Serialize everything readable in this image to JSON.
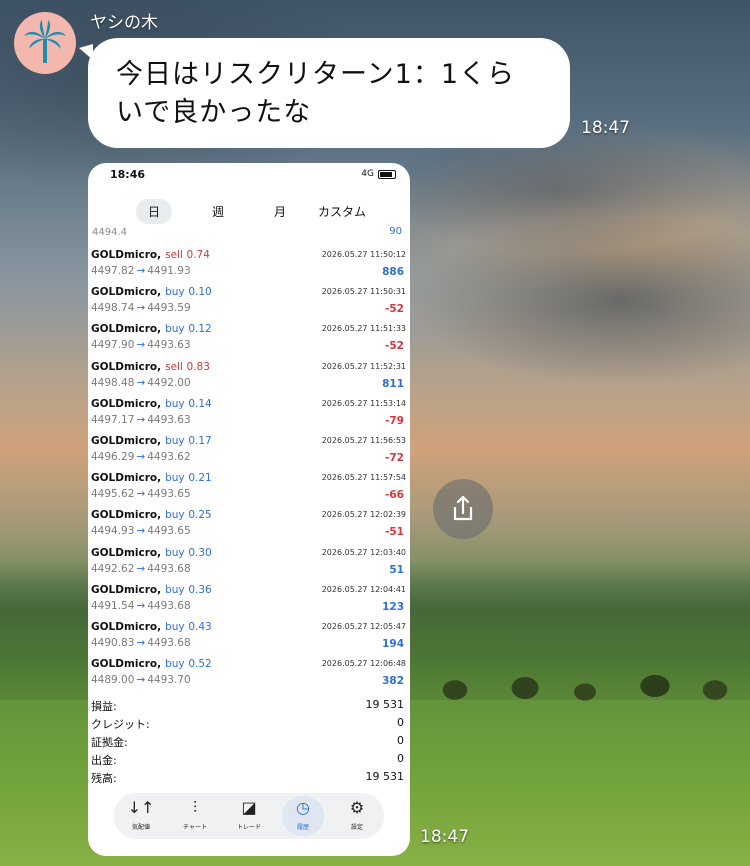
{
  "chat": {
    "sender_name": "ヤシの木",
    "message_text_line1": "今日はリスクリターン1：1くら",
    "message_text_line2": "いで良かったな",
    "message_time": "18:47",
    "image_time": "18:47",
    "avatar_icon": "palm-tree-icon",
    "share_icon": "share-icon"
  },
  "screenshot": {
    "status_time": "18:46",
    "status_right": "4G",
    "tabs": [
      {
        "label": "日",
        "active": true
      },
      {
        "label": "週",
        "active": false
      },
      {
        "label": "月",
        "active": false
      },
      {
        "label": "カスタム",
        "active": false
      }
    ],
    "strip": {
      "left": "4494.4",
      "right": "90"
    },
    "trades": [
      {
        "symbol": "GOLDmicro,",
        "side": "sell",
        "volume": "0.74",
        "datetime": "2026.05.27 11:50:12",
        "open": "4497.82",
        "close": "4491.93",
        "profit": "886",
        "profit_sign": "pos"
      },
      {
        "symbol": "GOLDmicro,",
        "side": "buy",
        "volume": "0.10",
        "datetime": "2026.05.27 11:50:31",
        "open": "4498.74",
        "close": "4493.59",
        "profit": "-52",
        "profit_sign": "neg"
      },
      {
        "symbol": "GOLDmicro,",
        "side": "buy",
        "volume": "0.12",
        "datetime": "2026.05.27 11:51:33",
        "open": "4497.90",
        "close": "4493.63",
        "profit": "-52",
        "profit_sign": "neg"
      },
      {
        "symbol": "GOLDmicro,",
        "side": "sell",
        "volume": "0.83",
        "datetime": "2026.05.27 11:52:31",
        "open": "4498.48",
        "close": "4492.00",
        "profit": "811",
        "profit_sign": "pos"
      },
      {
        "symbol": "GOLDmicro,",
        "side": "buy",
        "volume": "0.14",
        "datetime": "2026.05.27 11:53:14",
        "open": "4497.17",
        "close": "4493.63",
        "profit": "-79",
        "profit_sign": "neg"
      },
      {
        "symbol": "GOLDmicro,",
        "side": "buy",
        "volume": "0.17",
        "datetime": "2026.05.27 11:56:53",
        "open": "4496.29",
        "close": "4493.62",
        "profit": "-72",
        "profit_sign": "neg"
      },
      {
        "symbol": "GOLDmicro,",
        "side": "buy",
        "volume": "0.21",
        "datetime": "2026.05.27 11:57:54",
        "open": "4495.62",
        "close": "4493.65",
        "profit": "-66",
        "profit_sign": "neg"
      },
      {
        "symbol": "GOLDmicro,",
        "side": "buy",
        "volume": "0.25",
        "datetime": "2026.05.27 12:02:39",
        "open": "4494.93",
        "close": "4493.65",
        "profit": "-51",
        "profit_sign": "neg"
      },
      {
        "symbol": "GOLDmicro,",
        "side": "buy",
        "volume": "0.30",
        "datetime": "2026.05.27 12:03:40",
        "open": "4492.62",
        "close": "4493.68",
        "profit": "51",
        "profit_sign": "pos"
      },
      {
        "symbol": "GOLDmicro,",
        "side": "buy",
        "volume": "0.36",
        "datetime": "2026.05.27 12:04:41",
        "open": "4491.54",
        "close": "4493.68",
        "profit": "123",
        "profit_sign": "pos"
      },
      {
        "symbol": "GOLDmicro,",
        "side": "buy",
        "volume": "0.43",
        "datetime": "2026.05.27 12:05:47",
        "open": "4490.83",
        "close": "4493.68",
        "profit": "194",
        "profit_sign": "pos"
      },
      {
        "symbol": "GOLDmicro,",
        "side": "buy",
        "volume": "0.52",
        "datetime": "2026.05.27 12:06:48",
        "open": "4489.00",
        "close": "4493.70",
        "profit": "382",
        "profit_sign": "pos"
      }
    ],
    "summary": [
      {
        "label": "損益:",
        "value": "19 531"
      },
      {
        "label": "クレジット:",
        "value": "0"
      },
      {
        "label": "証拠金:",
        "value": "0"
      },
      {
        "label": "出金:",
        "value": "0"
      },
      {
        "label": "残高:",
        "value": "19 531"
      }
    ],
    "nav": [
      {
        "label": "気配値",
        "icon": "quotes-icon",
        "active": false
      },
      {
        "label": "チャート",
        "icon": "chart-icon",
        "active": false
      },
      {
        "label": "トレード",
        "icon": "trade-icon",
        "active": false
      },
      {
        "label": "履歴",
        "icon": "history-icon",
        "active": true
      },
      {
        "label": "設定",
        "icon": "settings-icon",
        "active": false
      }
    ]
  }
}
